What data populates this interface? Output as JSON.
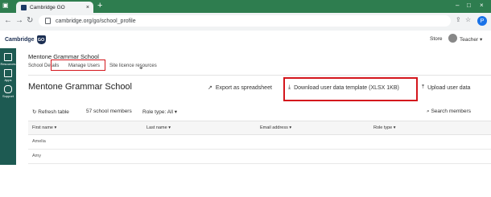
{
  "browser": {
    "tab_title": "Cambridge GO",
    "tab_close": "×",
    "new_tab": "+",
    "url": "cambridge.org/go/school_profile",
    "profile_initial": "P",
    "window_controls": [
      "–",
      "□",
      "×"
    ]
  },
  "app": {
    "logo_text": "Cambridge",
    "logo_badge": "GO",
    "store_label": "Store",
    "user_label": "Teacher",
    "user_chevron": "▾"
  },
  "sidenav": [
    {
      "icon": "resources-icon",
      "label": "Resources"
    },
    {
      "icon": "apps-icon",
      "label": "Apps"
    },
    {
      "icon": "support-icon",
      "label": "Support"
    }
  ],
  "school": {
    "name": "Mentone Grammar School",
    "tabs": [
      {
        "label": "School Details",
        "active": false
      },
      {
        "label": "Manage Users",
        "active": true
      },
      {
        "label": "Site licence resources",
        "active": false
      }
    ],
    "heading": "Mentone Grammar School"
  },
  "actions": {
    "export": "Export as spreadsheet",
    "download_template": "Download user data template (XLSX 1KB)",
    "upload": "Upload user data"
  },
  "toolbar": {
    "refresh": "Refresh table",
    "member_count": "57 school members",
    "role_type_label": "Role type:",
    "role_type_value": "All",
    "search": "Search members"
  },
  "table": {
    "columns": [
      "First name",
      "Last name",
      "Email address",
      "Role type"
    ],
    "rows": [
      {
        "first_name": "Amelia"
      },
      {
        "first_name": "Amy"
      }
    ]
  },
  "colors": {
    "highlight": "#d4161c",
    "brand": "#1b2e52",
    "sidenav": "#1d5a52"
  }
}
